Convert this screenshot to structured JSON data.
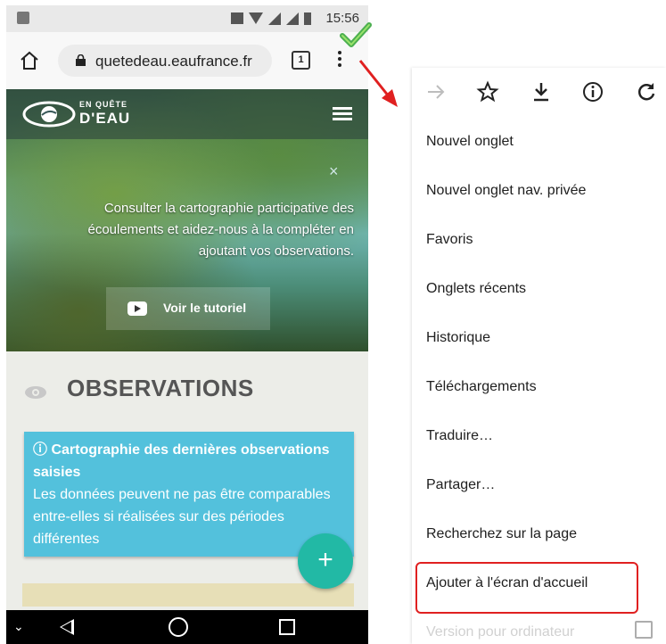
{
  "status_bar": {
    "time": "15:56"
  },
  "browser": {
    "url": "quetedeau.eaufrance.fr",
    "tab_count": "1"
  },
  "site": {
    "logo_top": "EN QUÊTE",
    "logo_bottom": "D'EAU",
    "close_glyph": "×",
    "hero_text": "Consulter la cartographie participative des écoulements et aidez-nous à la compléter en ajoutant vos observations.",
    "tutorial_label": "Voir le tutoriel",
    "section_title": "OBSERVATIONS",
    "info_title": "ⓘ Cartographie des dernières observations saisies",
    "info_body": "Les données peuvent ne pas être comparables entre-elles si réalisées sur des périodes différentes",
    "fab_label": "+"
  },
  "menu": {
    "toolbar_icons": [
      "forward-icon",
      "star-icon",
      "download-icon",
      "info-icon",
      "refresh-icon"
    ],
    "items": [
      "Nouvel onglet",
      "Nouvel onglet nav. privée",
      "Favoris",
      "Onglets récents",
      "Historique",
      "Téléchargements",
      "Traduire…",
      "Partager…",
      "Recherchez sur la page",
      "Ajouter à l'écran d'accueil"
    ],
    "highlighted_item": "Ajouter à l'écran d'accueil",
    "partial_item": "Version pour ordinateur"
  },
  "colors": {
    "accent_fab": "#22b9a5",
    "info_box": "#53c1dc",
    "highlight_border": "#e02020",
    "check_green": "#4caf50"
  }
}
